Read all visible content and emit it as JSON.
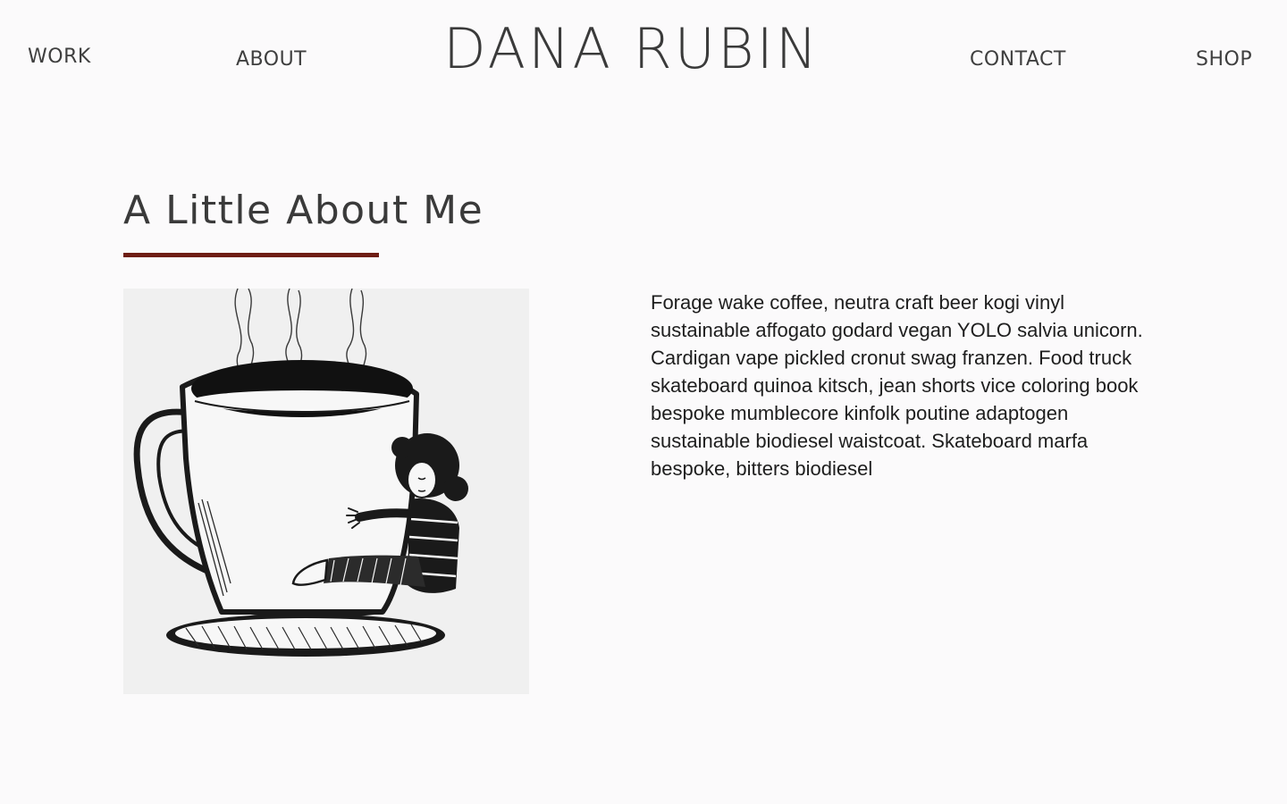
{
  "header": {
    "site_title": "DANA RUBIN",
    "nav": {
      "work": "WORK",
      "about": "ABOUT",
      "contact": "CONTACT",
      "shop": "SHOP"
    }
  },
  "about": {
    "heading": "A Little About Me",
    "accent_color": "#6e1d14",
    "illustration_icon": "woman-hugging-coffee-mug-drawing",
    "bio": "Forage wake coffee, neutra craft beer kogi vinyl sustainable affogato godard vegan YOLO salvia unicorn. Cardigan vape pickled cronut swag franzen. Food truck skateboard quinoa kitsch, jean shorts vice coloring book bespoke mumblecore kinfolk poutine adaptogen sustainable biodiesel waistcoat. Skateboard marfa bespoke, bitters biodiesel"
  }
}
